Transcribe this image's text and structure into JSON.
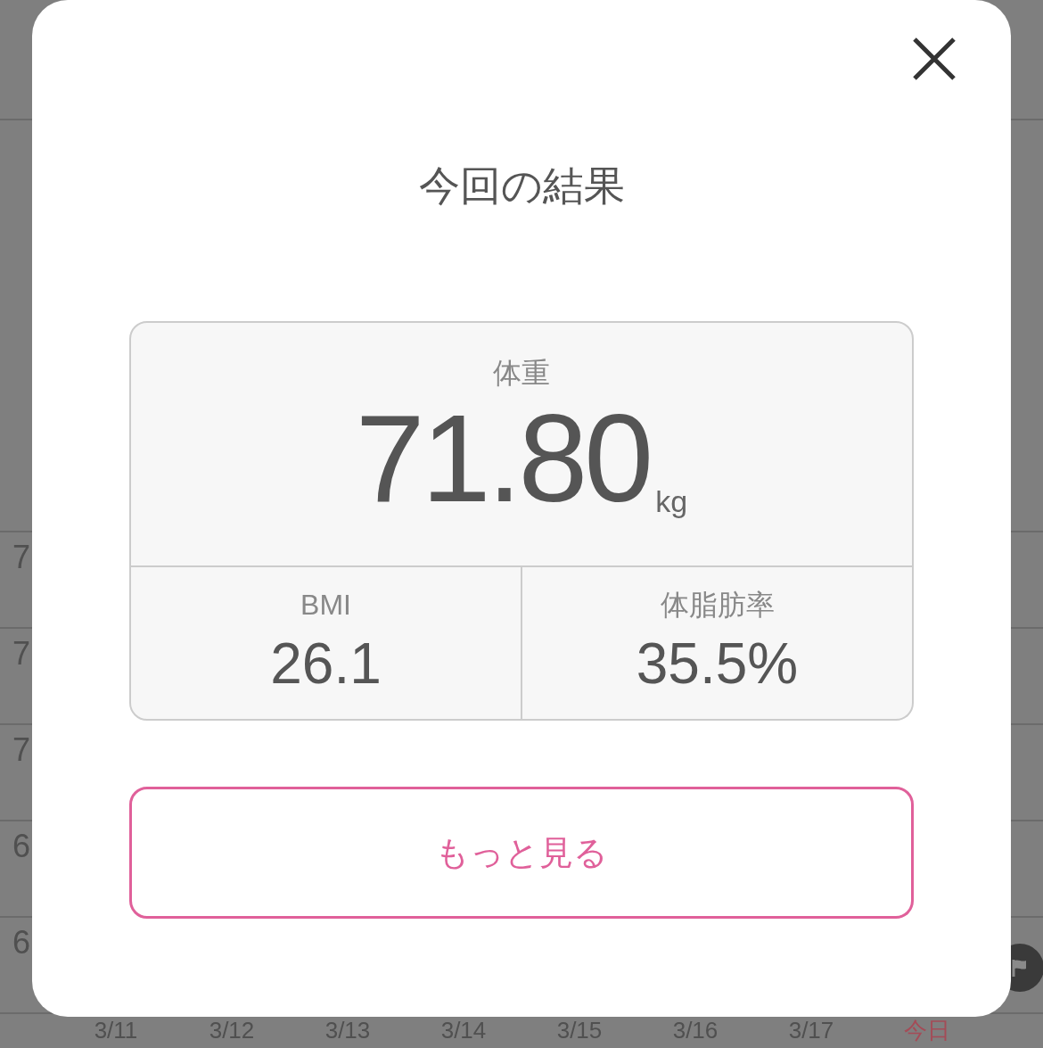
{
  "background": {
    "y_axis_labels": [
      "7",
      "7",
      "7",
      "6",
      "6"
    ],
    "dates": [
      {
        "label": "3/11",
        "today": false
      },
      {
        "label": "3/12",
        "today": false
      },
      {
        "label": "3/13",
        "today": false
      },
      {
        "label": "3/14",
        "today": false
      },
      {
        "label": "3/15",
        "today": false
      },
      {
        "label": "3/16",
        "today": false
      },
      {
        "label": "3/17",
        "today": false
      },
      {
        "label": "今日",
        "today": true
      }
    ]
  },
  "modal": {
    "title": "今回の結果",
    "weight": {
      "label": "体重",
      "value": "71.80",
      "unit": "kg"
    },
    "metrics": [
      {
        "label": "BMI",
        "value": "26.1"
      },
      {
        "label": "体脂肪率",
        "value": "35.5%"
      }
    ],
    "button": "もっと見る"
  }
}
